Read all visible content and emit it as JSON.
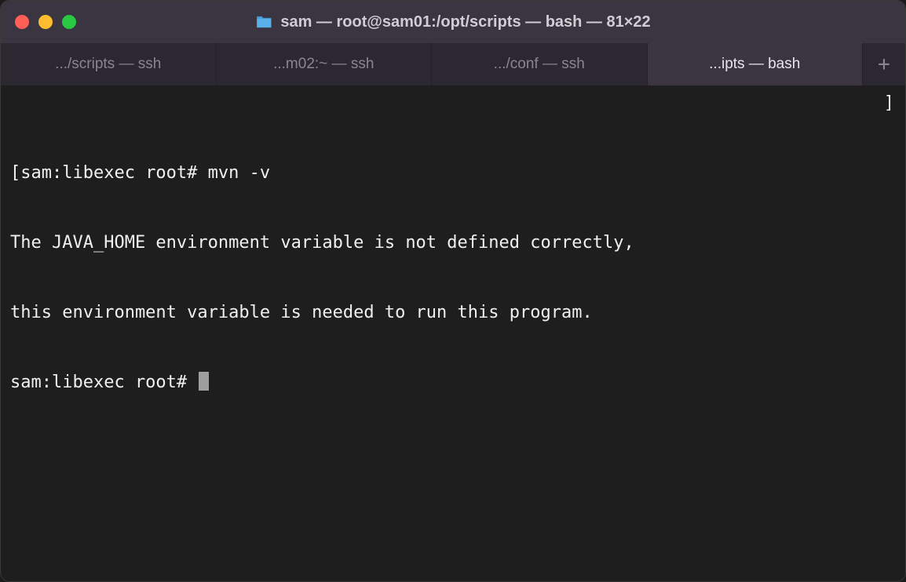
{
  "window": {
    "title": "sam — root@sam01:/opt/scripts — bash — 81×22"
  },
  "tabs": [
    {
      "label": ".../scripts — ssh",
      "active": false
    },
    {
      "label": "...m02:~ — ssh",
      "active": false
    },
    {
      "label": ".../conf — ssh",
      "active": false
    },
    {
      "label": "...ipts — bash",
      "active": true
    }
  ],
  "terminal": {
    "line1_prefix": "[",
    "line1_prompt": "sam:libexec root# ",
    "line1_cmd": "mvn -v",
    "line2": "The JAVA_HOME environment variable is not defined correctly,",
    "line3": "this environment variable is needed to run this program.",
    "line4_prompt": "sam:libexec root# ",
    "right_bracket": "]"
  }
}
